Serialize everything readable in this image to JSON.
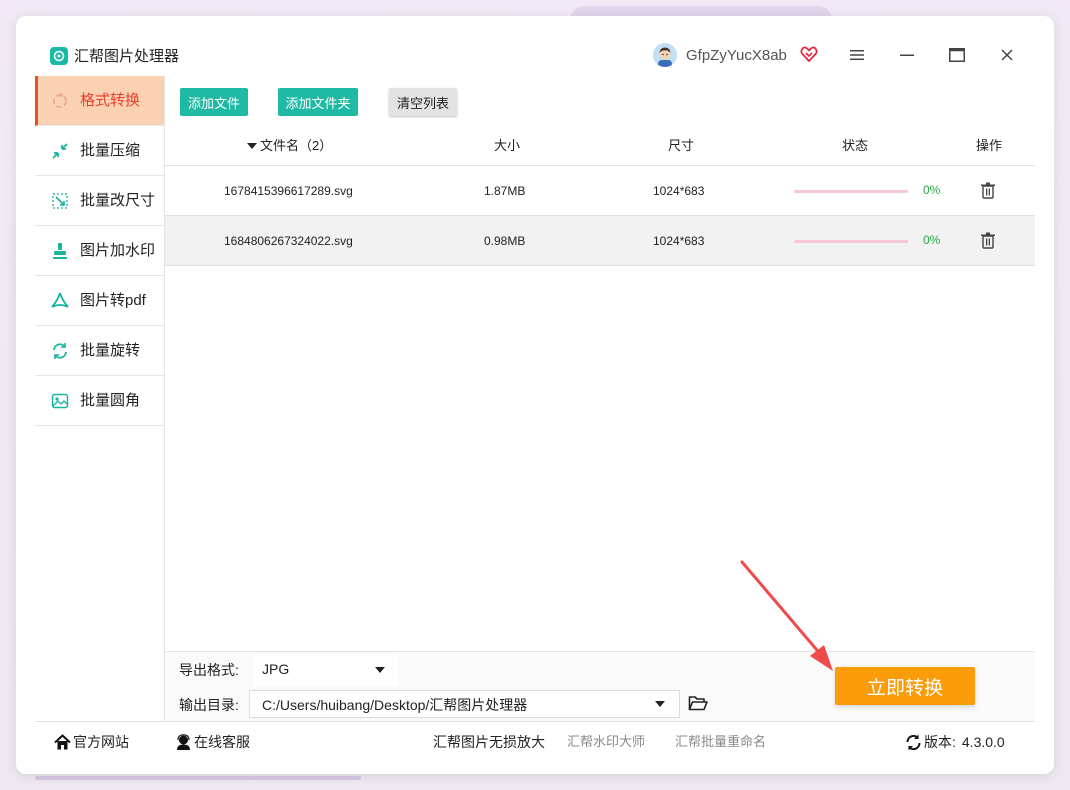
{
  "app": {
    "title": "汇帮图片处理器",
    "username": "GfpZyYucX8ab"
  },
  "sidebar": {
    "items": [
      {
        "label": "格式转换",
        "icon": "convert-icon",
        "active": true
      },
      {
        "label": "批量压缩",
        "icon": "compress-icon",
        "active": false
      },
      {
        "label": "批量改尺寸",
        "icon": "resize-icon",
        "active": false
      },
      {
        "label": "图片加水印",
        "icon": "watermark-icon",
        "active": false
      },
      {
        "label": "图片转pdf",
        "icon": "pdf-icon",
        "active": false
      },
      {
        "label": "批量旋转",
        "icon": "rotate-icon",
        "active": false
      },
      {
        "label": "批量圆角",
        "icon": "rounded-corner-icon",
        "active": false
      }
    ]
  },
  "toolbar": {
    "add_file": "添加文件",
    "add_folder": "添加文件夹",
    "clear_list": "清空列表"
  },
  "table": {
    "headers": {
      "filename": "文件名（2）",
      "size": "大小",
      "dimensions": "尺寸",
      "status": "状态",
      "actions": "操作"
    },
    "rows": [
      {
        "filename": "1678415396617289.svg",
        "size": "1.87MB",
        "dimensions": "1024*683",
        "progress": 0,
        "progress_text": "0%"
      },
      {
        "filename": "1684806267324022.svg",
        "size": "0.98MB",
        "dimensions": "1024*683",
        "progress": 0,
        "progress_text": "0%"
      }
    ]
  },
  "settings": {
    "format_label": "导出格式:",
    "format_value": "JPG",
    "dir_label": "输出目录:",
    "dir_value": "C:/Users/huibang/Desktop/汇帮图片处理器"
  },
  "convert_button": "立即转换",
  "footer": {
    "website": "官方网站",
    "support": "在线客服",
    "link1": "汇帮图片无损放大",
    "link2": "汇帮水印大师",
    "link3": "汇帮批量重命名",
    "version_label": "版本:",
    "version_value": "4.3.0.0"
  },
  "colors": {
    "accent_teal": "#1fb9a4",
    "active_bg": "#fbd1b4",
    "active_text": "#e8402a",
    "convert_orange": "#fb9c0a",
    "progress_bg": "#f7c7d3",
    "percent_green": "#28a745",
    "arrow_red": "#f04b4b"
  }
}
